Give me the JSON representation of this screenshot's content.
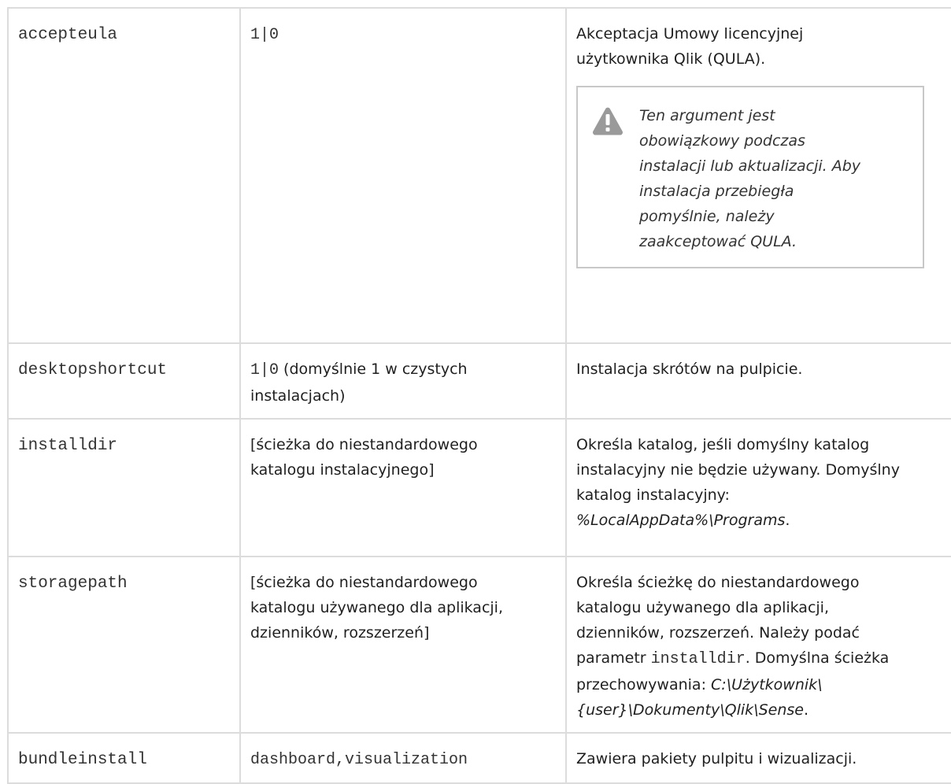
{
  "rows": [
    {
      "name": "accepteula",
      "value": "1|0",
      "desc_lines": [
        "Akceptacja Umowy licencyjnej",
        "użytkownika Qlik (QULA)."
      ],
      "warning": {
        "icon": "warning-icon",
        "lines": [
          "Ten argument jest",
          "obowiązkowy podczas",
          "instalacji lub aktualizacji. Aby",
          "instalacja przebiegła",
          "pomyślnie, należy",
          "zaakceptować QULA."
        ]
      }
    },
    {
      "name": "desktopshortcut",
      "value_code": "1|0",
      "value_rest_lines": [
        " (domyślnie 1 w czystych",
        "instalacjach)"
      ],
      "desc": "Instalacja skrótów na pulpicie."
    },
    {
      "name": "installdir",
      "value_lines": [
        "[ścieżka do niestandardowego",
        "katalogu instalacyjnego]"
      ],
      "desc_lines": [
        "Określa katalog, jeśli domyślny katalog",
        "instalacyjny nie będzie używany. Domyślny",
        "katalog instalacyjny:"
      ],
      "desc_path": " %LocalAppData%\\Programs",
      "desc_end": "."
    },
    {
      "name": "storagepath",
      "value_lines": [
        "[ścieżka do niestandardowego",
        "katalogu używanego dla aplikacji,",
        "dzienników, rozszerzeń]"
      ],
      "desc_lines": [
        "Określa ścieżkę do niestandardowego",
        "katalogu używanego dla aplikacji,",
        "dzienników, rozszerzeń. Należy podać"
      ],
      "desc_param_prefix": "parametr ",
      "desc_param_code": "installdir",
      "desc_param_suffix": ". Domyślna ścieżka",
      "desc_store_prefix": "przechowywania: ",
      "desc_path_line1": "C:\\Użytkownik\\",
      "desc_path_line2": "{user}\\Dokumenty\\Qlik\\Sense",
      "desc_end": "."
    },
    {
      "name": "bundleinstall",
      "value": "dashboard,visualization",
      "desc": "Zawiera pakiety pulpitu i wizualizacji."
    }
  ]
}
